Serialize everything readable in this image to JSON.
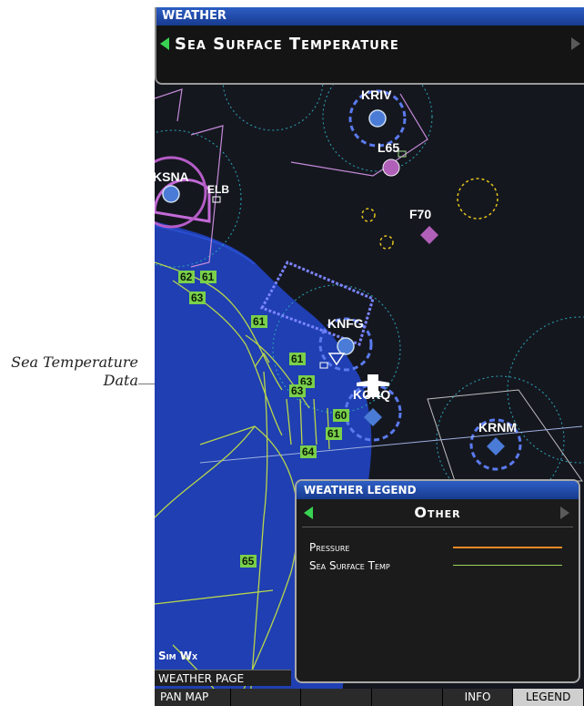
{
  "callout": {
    "line1": "Sea Temperature",
    "line2": "Data"
  },
  "header": {
    "title": "WEATHER",
    "selection": "Sea Surface Temperature"
  },
  "map": {
    "airports": [
      {
        "id": "KRIV",
        "label": "KRIV"
      },
      {
        "id": "L65",
        "label": "L65"
      },
      {
        "id": "KSNA",
        "label": "KSNA"
      },
      {
        "id": "ELB",
        "label": "ELB"
      },
      {
        "id": "F70",
        "label": "F70"
      },
      {
        "id": "KNFG",
        "label": "KNFG"
      },
      {
        "id": "KCRQ",
        "label": "KCRQ"
      },
      {
        "id": "KRNM",
        "label": "KRNM"
      }
    ],
    "sea_temps": [
      "62",
      "61",
      "63",
      "61",
      "61",
      "63",
      "63",
      "60",
      "61",
      "64",
      "65"
    ]
  },
  "legend": {
    "title": "WEATHER LEGEND",
    "selection": "Other",
    "items": [
      {
        "label": "Pressure",
        "color": "#f08a24"
      },
      {
        "label": "Sea Surface Temp",
        "color": "#9bd45a"
      }
    ]
  },
  "status": {
    "sim_wx": "Sim Wx",
    "page": "WEATHER PAGE"
  },
  "softkeys": [
    "PAN MAP",
    "",
    "",
    "",
    "INFO",
    "LEGEND"
  ],
  "colors": {
    "water": "#1f3fb2",
    "sea_temp_contour": "#b8d64a",
    "label_bg": "#7ad04a"
  }
}
